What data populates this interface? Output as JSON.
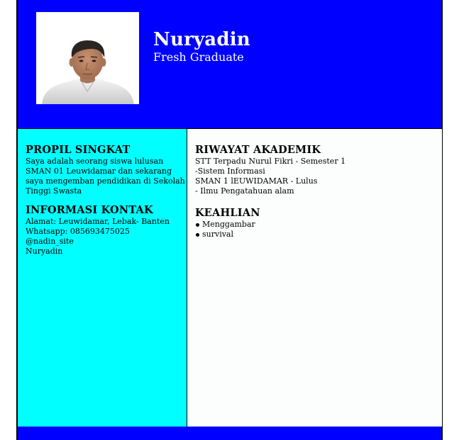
{
  "header": {
    "name": "Nuryadin",
    "title": "Fresh Graduate"
  },
  "profile": {
    "heading": "PROPIL SINGKAT",
    "lines": [
      "Saya adalah seorang siswa lulusan",
      "SMAN 01 Leuwidamar dan sekarang",
      "saya mengemban pendidikan di Sekolah",
      "Tinggi Swasta"
    ]
  },
  "contact": {
    "heading": "INFORMASI KONTAK",
    "lines": [
      "Alamat: Leuwidamar, Lebak- Banten",
      "Whatsapp: 085693475025",
      "@nadin_site",
      "Nuryadin"
    ]
  },
  "education": {
    "heading": "RIWAYAT AKADEMIK",
    "lines": [
      "STT Terpadu Nurul Fikri - Semester 1",
      "-Sistem Informasi",
      "SMAN 1 lEUWIDAMAR - Lulus",
      "- Ilmu Pengatahuan alam"
    ]
  },
  "skills": {
    "heading": "KEAHLIAN",
    "items": [
      "Menggambar",
      "survival"
    ]
  },
  "colors": {
    "header_bg": "#0000ff",
    "sidebar_bg": "#00ffff",
    "main_bg": "#fcfefe",
    "footer_bg": "#0000ff"
  }
}
